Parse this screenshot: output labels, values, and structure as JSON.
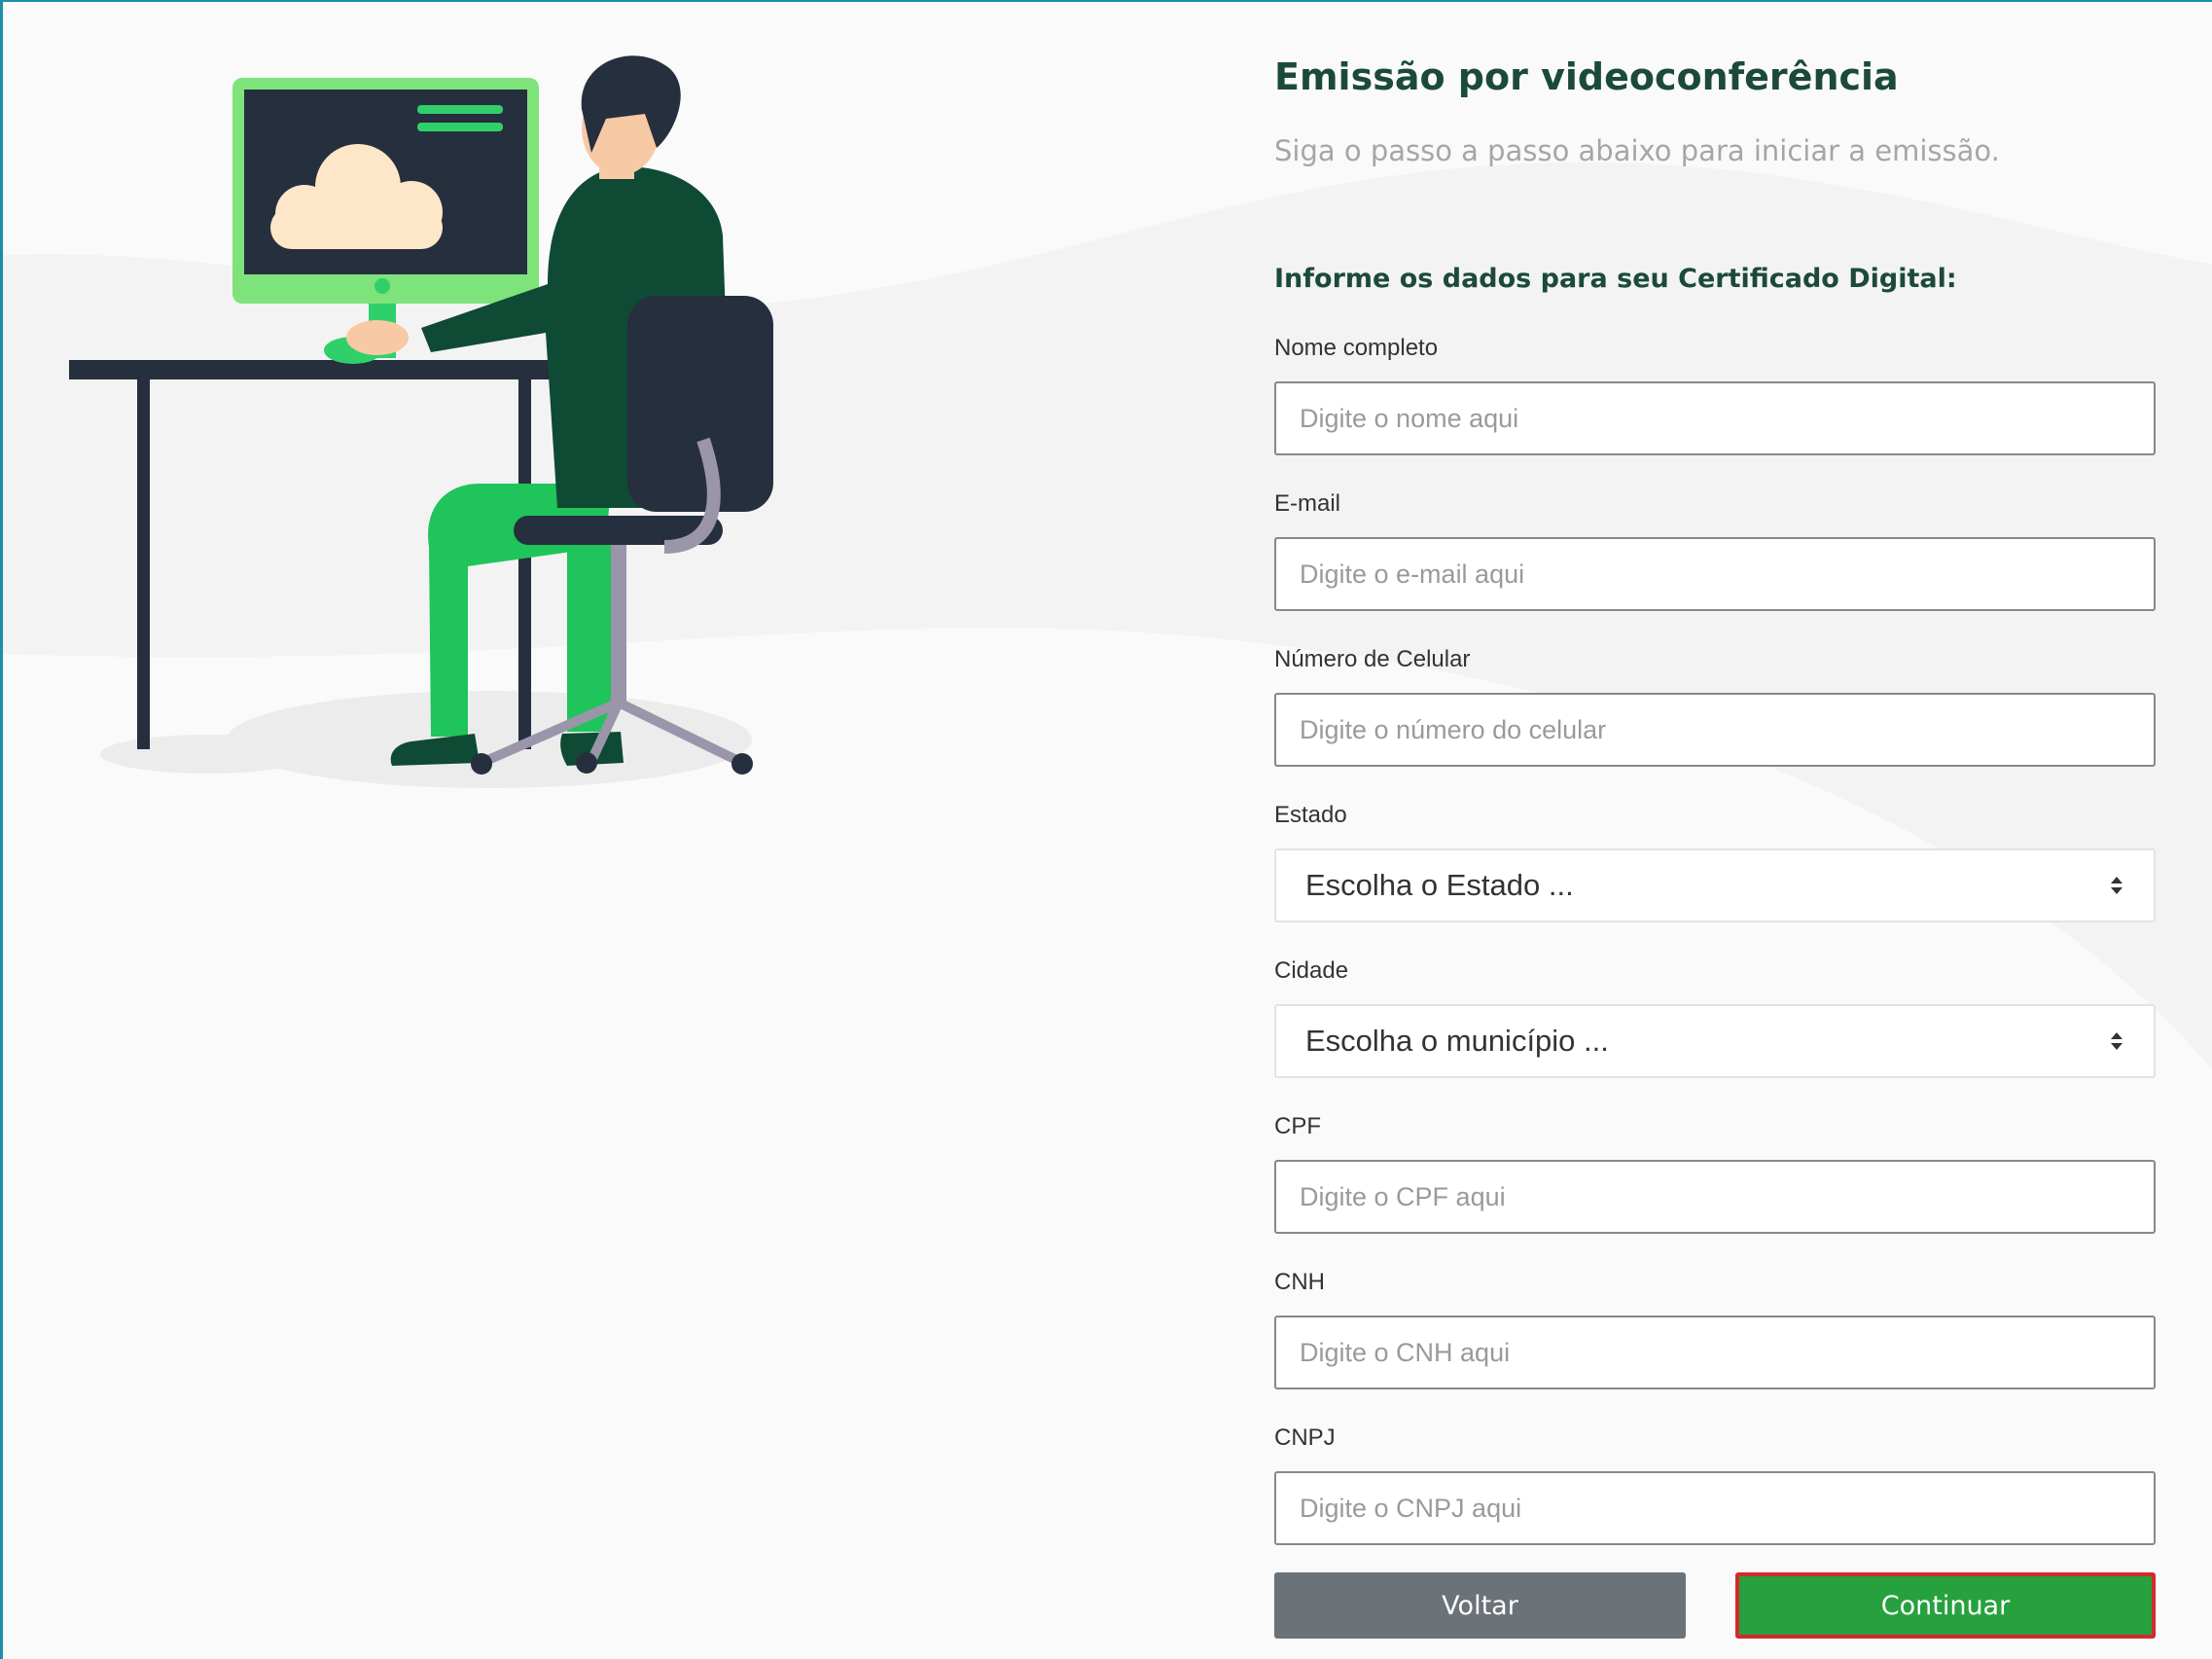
{
  "header": {
    "title": "Emissão por videoconferência",
    "subtitle": "Siga o passo a passo abaixo para iniciar a emissão."
  },
  "form": {
    "section_title": "Informe os dados para seu Certificado Digital:",
    "fields": {
      "nome": {
        "label": "Nome completo",
        "placeholder": "Digite o nome aqui",
        "value": ""
      },
      "email": {
        "label": "E-mail",
        "placeholder": "Digite o e-mail aqui",
        "value": ""
      },
      "celular": {
        "label": "Número de Celular",
        "placeholder": "Digite o número do celular",
        "value": ""
      },
      "estado": {
        "label": "Estado",
        "selected": "Escolha o Estado ..."
      },
      "cidade": {
        "label": "Cidade",
        "selected": "Escolha o município ..."
      },
      "cpf": {
        "label": "CPF",
        "placeholder": "Digite o CPF aqui",
        "value": ""
      },
      "cnh": {
        "label": "CNH",
        "placeholder": "Digite o CNH aqui",
        "value": ""
      },
      "cnpj": {
        "label": "CNPJ",
        "placeholder": "Digite o CNPJ aqui",
        "value": ""
      }
    },
    "buttons": {
      "back": "Voltar",
      "continue": "Continuar"
    }
  },
  "colors": {
    "title": "#1c4a3a",
    "back_button": "#6b7278",
    "continue_button": "#27a13e",
    "highlight_outline": "#d42a2a",
    "frame_border": "#1e8ea8",
    "illustration_green": "#1fc45a",
    "illustration_dark_green": "#0f4a34"
  },
  "illustration": {
    "description_icon": "person-at-computer-illustration",
    "monitor_icon": "cloud-icon"
  }
}
